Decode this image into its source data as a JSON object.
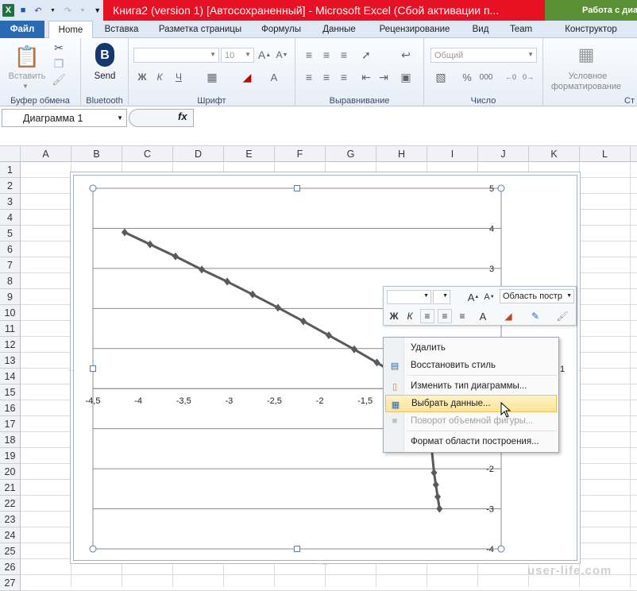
{
  "window": {
    "title": "Книга2 (version 1) [Автосохраненный]  -  Microsoft Excel (Сбой активации п...",
    "context_title": "Работа с диа"
  },
  "tabs": [
    "Файл",
    "Home",
    "Вставка",
    "Разметка страницы",
    "Формулы",
    "Данные",
    "Рецензирование",
    "Вид",
    "Team",
    "Конструктор"
  ],
  "ribbon": {
    "clipboard": {
      "paste": "Вставить",
      "label": "Буфер обмена"
    },
    "bluetooth": {
      "send": "Send",
      "label": "Bluetooth"
    },
    "font": {
      "label": "Шрифт",
      "size": "10",
      "bold": "Ж",
      "italic": "К",
      "underline": "Ч"
    },
    "alignment": {
      "label": "Выравнивание"
    },
    "number": {
      "label": "Число",
      "format": "Общий",
      "percent": "%",
      "thousands": "000"
    },
    "styles": {
      "conditional1": "Условное",
      "conditional2": "форматирование"
    },
    "partial_label": "Ст"
  },
  "formula_bar": {
    "name_box": "Диаграмма 1",
    "fx": "fx"
  },
  "columns": [
    "A",
    "B",
    "C",
    "D",
    "E",
    "F",
    "G",
    "H",
    "I",
    "J",
    "K",
    "L"
  ],
  "rows": [
    "1",
    "2",
    "3",
    "4",
    "5",
    "6",
    "7",
    "8",
    "9",
    "10",
    "11",
    "12",
    "13",
    "14",
    "15",
    "16",
    "17",
    "18",
    "19",
    "20",
    "21",
    "22",
    "23",
    "24",
    "25",
    "26",
    "27"
  ],
  "chart_data": {
    "type": "line",
    "x_tick_labels": [
      "-4,5",
      "-4",
      "-3,5",
      "-3",
      "-2,5",
      "-2",
      "-1,5"
    ],
    "y_tick_labels_top": [
      "5",
      "4",
      "3"
    ],
    "y_tick_labels_bottom": [
      "-2",
      "-3",
      "-4"
    ],
    "y_tick_label_partial": "1",
    "xlim": [
      -4.5,
      0
    ],
    "ylim": [
      -4,
      5
    ],
    "grid": true,
    "series": [
      {
        "color": "#5a5a5a",
        "x": [
          -4.15,
          -3.87,
          -3.59,
          -3.3,
          -3.02,
          -2.74,
          -2.46,
          -2.18,
          -1.9,
          -1.62,
          -1.37,
          -1.12,
          -0.97,
          -0.84,
          -0.77,
          -0.74,
          -0.72,
          -0.7,
          -0.68
        ],
        "y": [
          3.9,
          3.6,
          3.3,
          2.97,
          2.67,
          2.35,
          2.02,
          1.68,
          1.33,
          0.98,
          0.65,
          0.3,
          0.0,
          -0.6,
          -1.4,
          -2.1,
          -2.4,
          -2.7,
          -3.0
        ]
      }
    ]
  },
  "mini_toolbar": {
    "area_label": "Область постр",
    "bold": "Ж",
    "italic": "К"
  },
  "context_menu": {
    "items": [
      {
        "label": "Удалить",
        "enabled": true,
        "highlighted": false
      },
      {
        "label": "Восстановить стиль",
        "enabled": true,
        "highlighted": false
      },
      {
        "label": "Изменить тип диаграммы...",
        "enabled": true,
        "highlighted": false
      },
      {
        "label": "Выбрать данные...",
        "enabled": true,
        "highlighted": true
      },
      {
        "label": "Поворот объемной фигуры...",
        "enabled": false,
        "highlighted": false
      },
      {
        "label": "Формат области построения...",
        "enabled": true,
        "highlighted": false
      }
    ]
  },
  "watermark": "user-life.com",
  "colors": {
    "file_tab": "#2a6ab4",
    "title_red": "#e81123",
    "title_green": "#5a8f33",
    "menu_highlight": "#fce394",
    "line": "#5a5a5a"
  }
}
